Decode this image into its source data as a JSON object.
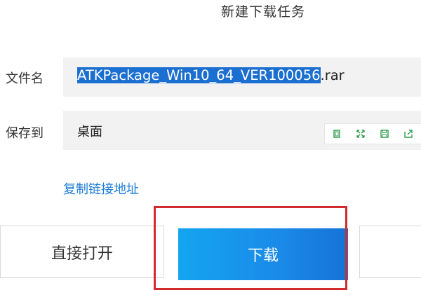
{
  "dialog": {
    "title": "新建下载任务"
  },
  "filename": {
    "label": "文件名",
    "selected_text": "ATKPackage_Win10_64_VER100056",
    "extension": ".rar"
  },
  "save_to": {
    "label": "保存到",
    "value": "桌面",
    "tools": [
      "copy-icon",
      "expand-icon",
      "save-icon",
      "open-folder-icon"
    ]
  },
  "links": {
    "copy_link": "复制链接地址"
  },
  "buttons": {
    "open_direct": "直接打开",
    "download": "下载"
  },
  "colors": {
    "selection": "#1a6fd1",
    "link": "#1e7ed8",
    "primary_button": "#1a8ae8",
    "annotation_box": "#d12b2b",
    "tool_icon": "#2e9e4f"
  }
}
